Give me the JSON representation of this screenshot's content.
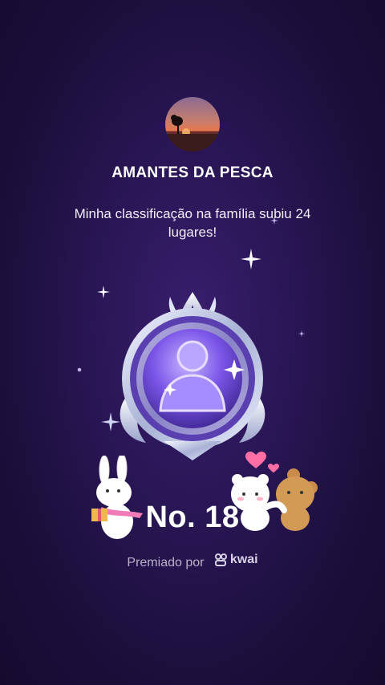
{
  "family": {
    "name": "AMANTES DA PESCA",
    "avatar_icon": "sunset-tree-avatar"
  },
  "message": "Minha classificação na família subiu 24 lugares!",
  "rank": {
    "text": "No. 18"
  },
  "awarded": {
    "label": "Premiado por",
    "brand": "kwai",
    "brand_icon": "kwai-logo-icon"
  },
  "colors": {
    "background": "#1b0f3b",
    "badge_purple": "#7b55e8",
    "badge_silver": "#c9d0e8",
    "text_muted": "#b9b1cc"
  },
  "decorations": [
    "sparkle-star-icon",
    "bunny-with-gift-sticker",
    "hugging-bears-sticker",
    "heart-icon"
  ]
}
